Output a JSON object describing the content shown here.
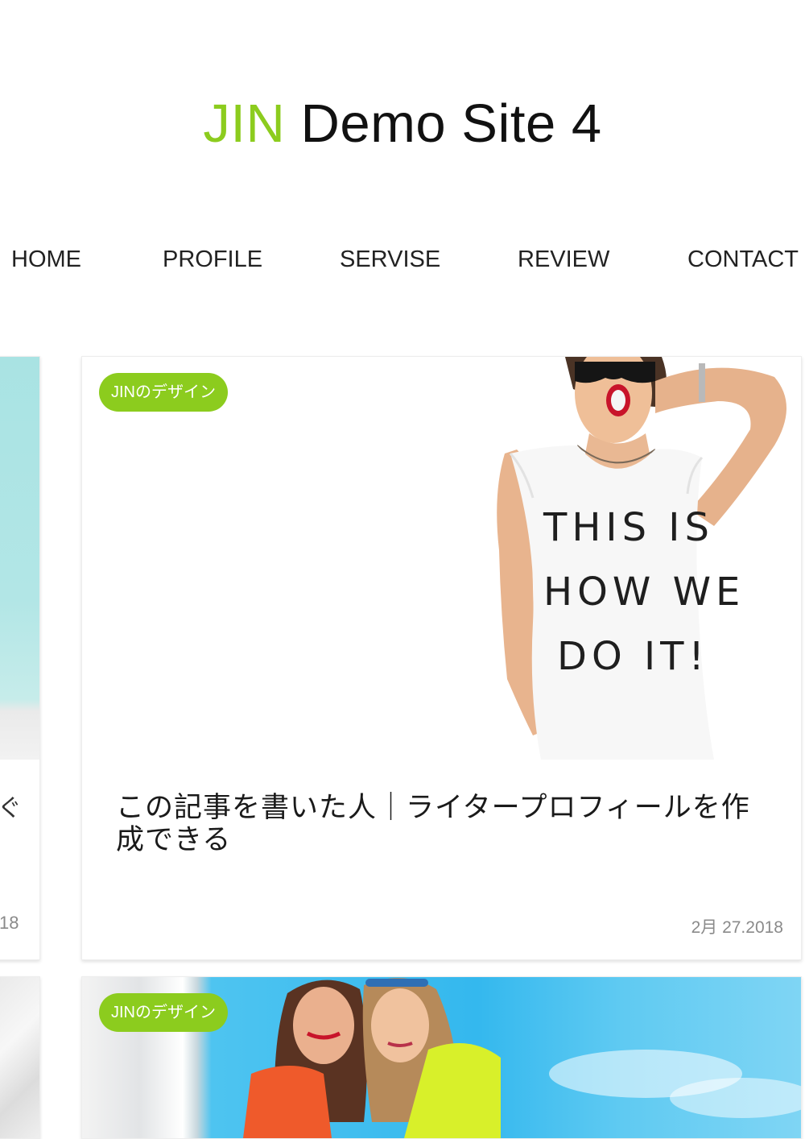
{
  "header": {
    "title_accent": "JIN",
    "title_rest": "Demo Site 4"
  },
  "nav": {
    "items": [
      {
        "label": "HOME"
      },
      {
        "label": "PROFILE"
      },
      {
        "label": "SERVISE"
      },
      {
        "label": "REVIEW"
      },
      {
        "label": "CONTACT"
      }
    ]
  },
  "left_cards": [
    {
      "title_fragment": "ぐ",
      "date_fragment": "18"
    }
  ],
  "posts": [
    {
      "category": "JINのデザイン",
      "title": "この記事を書いた人｜ライタープロフィールを作成できる",
      "date": "2月 27.2018",
      "shirt_text_line1": "THIS IS",
      "shirt_text_line2": "HOW WE",
      "shirt_text_line3": "DO IT!"
    },
    {
      "category": "JINのデザイン"
    }
  ],
  "colors": {
    "accent": "#8ccc1e",
    "text": "#1a1a1a",
    "date": "#8a8a8a"
  }
}
